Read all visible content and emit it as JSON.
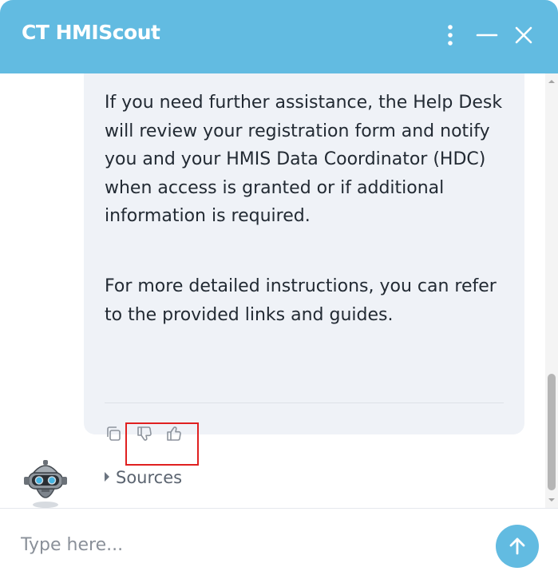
{
  "header": {
    "title": "CT HMIScout"
  },
  "message": {
    "paragraphs": [
      "If you need further assistance, the Help Desk will review your registration form and notify you and your HMIS Data Coordinator (HDC) when access is granted or if additional information is required.",
      "For more detailed instructions, you can refer to the provided links and guides."
    ],
    "sources_label": "Sources"
  },
  "composer": {
    "placeholder": "Type here..."
  },
  "icons": {
    "menu": "kebab-menu-icon",
    "minimize": "minimize-icon",
    "close": "close-icon",
    "copy": "copy-icon",
    "dislike": "thumbs-down-icon",
    "like": "thumbs-up-icon",
    "send": "arrow-up-icon",
    "avatar": "robot-avatar"
  },
  "colors": {
    "accent": "#62bbe1",
    "bubble": "#eff2f7",
    "highlight": "#e02020"
  }
}
